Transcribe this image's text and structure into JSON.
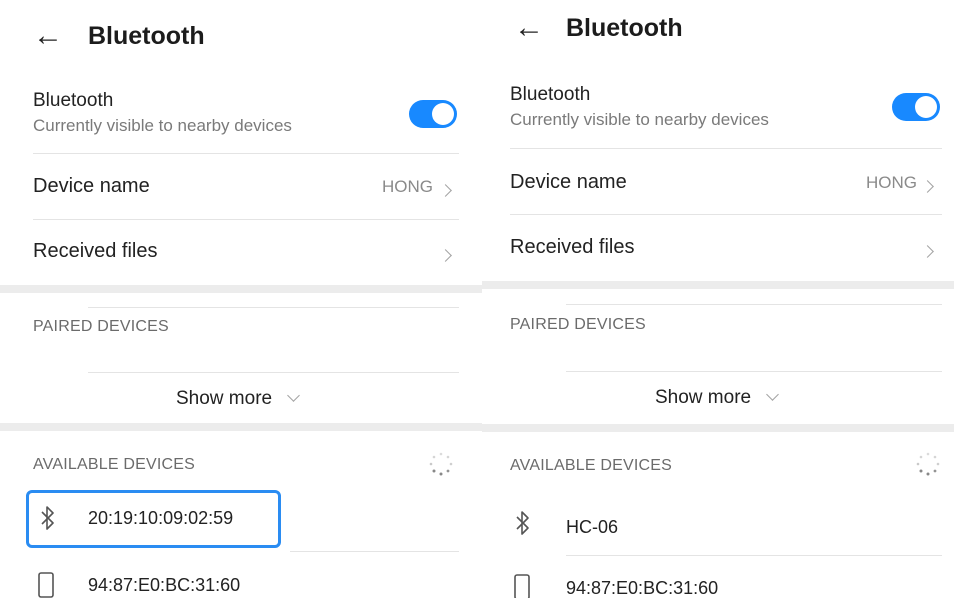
{
  "left": {
    "title": "Bluetooth",
    "bluetooth_row": {
      "label": "Bluetooth",
      "subtitle": "Currently visible to nearby devices",
      "enabled": true
    },
    "device_name": {
      "label": "Device name",
      "value": "HONG"
    },
    "received_files": {
      "label": "Received files"
    },
    "paired_header": "PAIRED DEVICES",
    "show_more": "Show more",
    "available_header": "AVAILABLE DEVICES",
    "devices": [
      {
        "name": "20:19:10:09:02:59",
        "icon": "bluetooth-icon",
        "highlighted": true
      },
      {
        "name": "94:87:E0:BC:31:60",
        "icon": "phone-icon",
        "highlighted": false
      }
    ]
  },
  "right": {
    "title": "Bluetooth",
    "bluetooth_row": {
      "label": "Bluetooth",
      "subtitle": "Currently visible to nearby devices",
      "enabled": true
    },
    "device_name": {
      "label": "Device name",
      "value": "HONG"
    },
    "received_files": {
      "label": "Received files"
    },
    "paired_header": "PAIRED DEVICES",
    "show_more": "Show more",
    "available_header": "AVAILABLE DEVICES",
    "devices": [
      {
        "name": "HC-06",
        "icon": "bluetooth-icon"
      },
      {
        "name": "94:87:E0:BC:31:60",
        "icon": "phone-icon"
      }
    ]
  },
  "colors": {
    "accent": "#1889ff",
    "highlight": "#2a8cf2",
    "band": "#ececec"
  }
}
